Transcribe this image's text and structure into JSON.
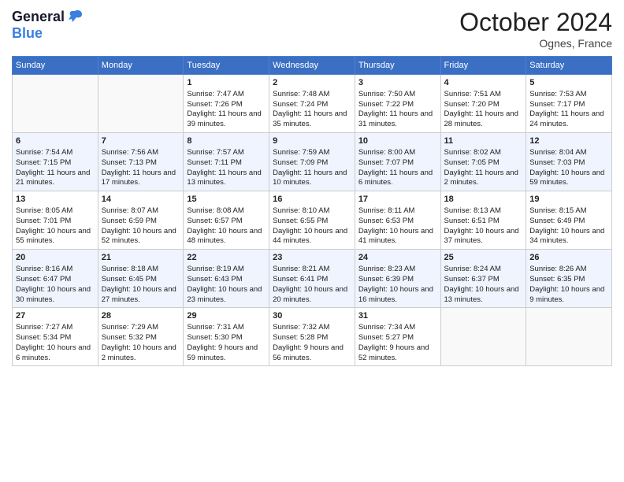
{
  "header": {
    "logo_line1": "General",
    "logo_line2": "Blue",
    "month": "October 2024",
    "location": "Ognes, France"
  },
  "weekdays": [
    "Sunday",
    "Monday",
    "Tuesday",
    "Wednesday",
    "Thursday",
    "Friday",
    "Saturday"
  ],
  "weeks": [
    [
      {
        "day": "",
        "sunrise": "",
        "sunset": "",
        "daylight": ""
      },
      {
        "day": "",
        "sunrise": "",
        "sunset": "",
        "daylight": ""
      },
      {
        "day": "1",
        "sunrise": "Sunrise: 7:47 AM",
        "sunset": "Sunset: 7:26 PM",
        "daylight": "Daylight: 11 hours and 39 minutes."
      },
      {
        "day": "2",
        "sunrise": "Sunrise: 7:48 AM",
        "sunset": "Sunset: 7:24 PM",
        "daylight": "Daylight: 11 hours and 35 minutes."
      },
      {
        "day": "3",
        "sunrise": "Sunrise: 7:50 AM",
        "sunset": "Sunset: 7:22 PM",
        "daylight": "Daylight: 11 hours and 31 minutes."
      },
      {
        "day": "4",
        "sunrise": "Sunrise: 7:51 AM",
        "sunset": "Sunset: 7:20 PM",
        "daylight": "Daylight: 11 hours and 28 minutes."
      },
      {
        "day": "5",
        "sunrise": "Sunrise: 7:53 AM",
        "sunset": "Sunset: 7:17 PM",
        "daylight": "Daylight: 11 hours and 24 minutes."
      }
    ],
    [
      {
        "day": "6",
        "sunrise": "Sunrise: 7:54 AM",
        "sunset": "Sunset: 7:15 PM",
        "daylight": "Daylight: 11 hours and 21 minutes."
      },
      {
        "day": "7",
        "sunrise": "Sunrise: 7:56 AM",
        "sunset": "Sunset: 7:13 PM",
        "daylight": "Daylight: 11 hours and 17 minutes."
      },
      {
        "day": "8",
        "sunrise": "Sunrise: 7:57 AM",
        "sunset": "Sunset: 7:11 PM",
        "daylight": "Daylight: 11 hours and 13 minutes."
      },
      {
        "day": "9",
        "sunrise": "Sunrise: 7:59 AM",
        "sunset": "Sunset: 7:09 PM",
        "daylight": "Daylight: 11 hours and 10 minutes."
      },
      {
        "day": "10",
        "sunrise": "Sunrise: 8:00 AM",
        "sunset": "Sunset: 7:07 PM",
        "daylight": "Daylight: 11 hours and 6 minutes."
      },
      {
        "day": "11",
        "sunrise": "Sunrise: 8:02 AM",
        "sunset": "Sunset: 7:05 PM",
        "daylight": "Daylight: 11 hours and 2 minutes."
      },
      {
        "day": "12",
        "sunrise": "Sunrise: 8:04 AM",
        "sunset": "Sunset: 7:03 PM",
        "daylight": "Daylight: 10 hours and 59 minutes."
      }
    ],
    [
      {
        "day": "13",
        "sunrise": "Sunrise: 8:05 AM",
        "sunset": "Sunset: 7:01 PM",
        "daylight": "Daylight: 10 hours and 55 minutes."
      },
      {
        "day": "14",
        "sunrise": "Sunrise: 8:07 AM",
        "sunset": "Sunset: 6:59 PM",
        "daylight": "Daylight: 10 hours and 52 minutes."
      },
      {
        "day": "15",
        "sunrise": "Sunrise: 8:08 AM",
        "sunset": "Sunset: 6:57 PM",
        "daylight": "Daylight: 10 hours and 48 minutes."
      },
      {
        "day": "16",
        "sunrise": "Sunrise: 8:10 AM",
        "sunset": "Sunset: 6:55 PM",
        "daylight": "Daylight: 10 hours and 44 minutes."
      },
      {
        "day": "17",
        "sunrise": "Sunrise: 8:11 AM",
        "sunset": "Sunset: 6:53 PM",
        "daylight": "Daylight: 10 hours and 41 minutes."
      },
      {
        "day": "18",
        "sunrise": "Sunrise: 8:13 AM",
        "sunset": "Sunset: 6:51 PM",
        "daylight": "Daylight: 10 hours and 37 minutes."
      },
      {
        "day": "19",
        "sunrise": "Sunrise: 8:15 AM",
        "sunset": "Sunset: 6:49 PM",
        "daylight": "Daylight: 10 hours and 34 minutes."
      }
    ],
    [
      {
        "day": "20",
        "sunrise": "Sunrise: 8:16 AM",
        "sunset": "Sunset: 6:47 PM",
        "daylight": "Daylight: 10 hours and 30 minutes."
      },
      {
        "day": "21",
        "sunrise": "Sunrise: 8:18 AM",
        "sunset": "Sunset: 6:45 PM",
        "daylight": "Daylight: 10 hours and 27 minutes."
      },
      {
        "day": "22",
        "sunrise": "Sunrise: 8:19 AM",
        "sunset": "Sunset: 6:43 PM",
        "daylight": "Daylight: 10 hours and 23 minutes."
      },
      {
        "day": "23",
        "sunrise": "Sunrise: 8:21 AM",
        "sunset": "Sunset: 6:41 PM",
        "daylight": "Daylight: 10 hours and 20 minutes."
      },
      {
        "day": "24",
        "sunrise": "Sunrise: 8:23 AM",
        "sunset": "Sunset: 6:39 PM",
        "daylight": "Daylight: 10 hours and 16 minutes."
      },
      {
        "day": "25",
        "sunrise": "Sunrise: 8:24 AM",
        "sunset": "Sunset: 6:37 PM",
        "daylight": "Daylight: 10 hours and 13 minutes."
      },
      {
        "day": "26",
        "sunrise": "Sunrise: 8:26 AM",
        "sunset": "Sunset: 6:35 PM",
        "daylight": "Daylight: 10 hours and 9 minutes."
      }
    ],
    [
      {
        "day": "27",
        "sunrise": "Sunrise: 7:27 AM",
        "sunset": "Sunset: 5:34 PM",
        "daylight": "Daylight: 10 hours and 6 minutes."
      },
      {
        "day": "28",
        "sunrise": "Sunrise: 7:29 AM",
        "sunset": "Sunset: 5:32 PM",
        "daylight": "Daylight: 10 hours and 2 minutes."
      },
      {
        "day": "29",
        "sunrise": "Sunrise: 7:31 AM",
        "sunset": "Sunset: 5:30 PM",
        "daylight": "Daylight: 9 hours and 59 minutes."
      },
      {
        "day": "30",
        "sunrise": "Sunrise: 7:32 AM",
        "sunset": "Sunset: 5:28 PM",
        "daylight": "Daylight: 9 hours and 56 minutes."
      },
      {
        "day": "31",
        "sunrise": "Sunrise: 7:34 AM",
        "sunset": "Sunset: 5:27 PM",
        "daylight": "Daylight: 9 hours and 52 minutes."
      },
      {
        "day": "",
        "sunrise": "",
        "sunset": "",
        "daylight": ""
      },
      {
        "day": "",
        "sunrise": "",
        "sunset": "",
        "daylight": ""
      }
    ]
  ]
}
